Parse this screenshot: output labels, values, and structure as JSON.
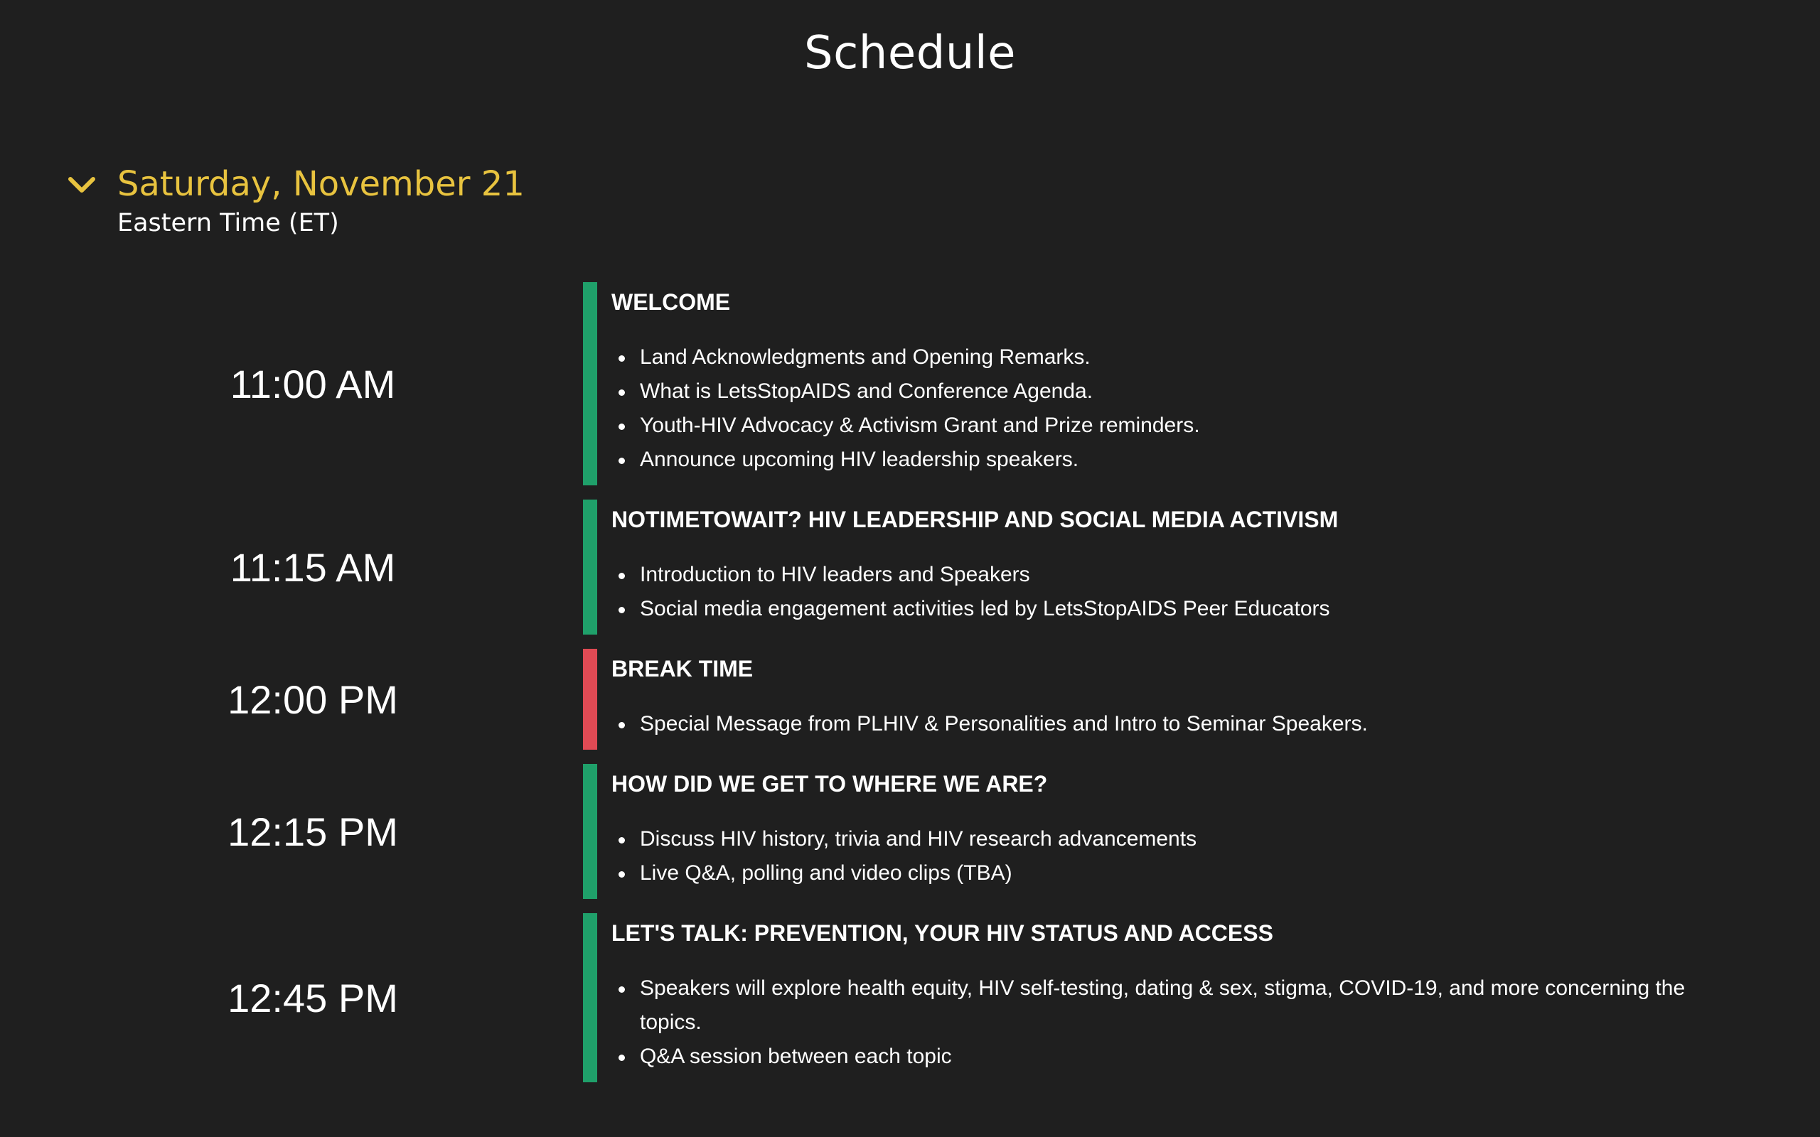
{
  "page": {
    "title": "Schedule"
  },
  "day": {
    "date": "Saturday, November 21",
    "timezone": "Eastern Time (ET)",
    "accent_color": "#e8c33f",
    "toggle_icon": "chevron-down-icon"
  },
  "sessions": [
    {
      "time": "11:00 AM",
      "title": "WELCOME",
      "status_color": "#1fa06a",
      "bullets": [
        "Land Acknowledgments and Opening Remarks.",
        "What is LetsStopAIDS and Conference Agenda.",
        "Youth-HIV Advocacy & Activism Grant and Prize reminders.",
        "Announce upcoming HIV leadership speakers."
      ]
    },
    {
      "time": "11:15 AM",
      "title": "NOTIMETOWAIT? HIV LEADERSHIP AND SOCIAL MEDIA ACTIVISM",
      "status_color": "#1fa06a",
      "bullets": [
        "Introduction to HIV leaders and Speakers",
        "Social media engagement activities led by LetsStopAIDS Peer Educators"
      ]
    },
    {
      "time": "12:00 PM",
      "title": "BREAK TIME",
      "status_color": "#e04a54",
      "bullets": [
        "Special Message from PLHIV & Personalities and Intro to Seminar Speakers."
      ]
    },
    {
      "time": "12:15 PM",
      "title": "HOW DID WE GET TO WHERE WE ARE?",
      "status_color": "#1fa06a",
      "bullets": [
        "Discuss HIV history, trivia and HIV research advancements",
        "Live Q&A, polling and video clips (TBA)"
      ]
    },
    {
      "time": "12:45 PM",
      "title": "LET'S TALK: PREVENTION, YOUR HIV STATUS AND ACCESS",
      "status_color": "#1fa06a",
      "bullets": [
        "Speakers will explore health equity, HIV self-testing, dating & sex, stigma, COVID-19, and more concerning the topics.",
        "Q&A session between each topic"
      ]
    }
  ]
}
